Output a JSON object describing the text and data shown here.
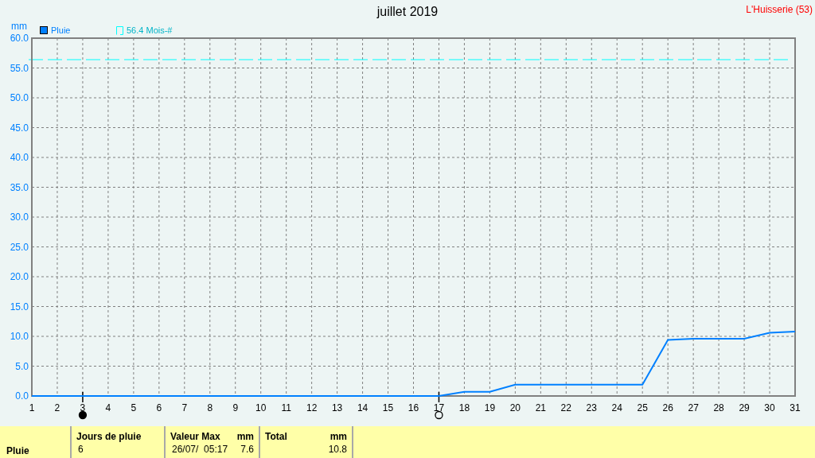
{
  "title": "juillet 2019",
  "location": "L'Huisserie (53)",
  "chart": {
    "chart_data": {
      "type": "line",
      "ylabel": "mm",
      "x": [
        1,
        2,
        3,
        4,
        5,
        6,
        7,
        8,
        9,
        10,
        11,
        12,
        13,
        14,
        15,
        16,
        17,
        18,
        19,
        20,
        21,
        22,
        23,
        24,
        25,
        26,
        27,
        28,
        29,
        30,
        31
      ],
      "xticks": [
        1,
        2,
        3,
        4,
        5,
        6,
        7,
        8,
        9,
        10,
        11,
        12,
        13,
        14,
        15,
        16,
        17,
        18,
        19,
        20,
        21,
        22,
        23,
        24,
        25,
        26,
        27,
        28,
        29,
        30,
        31
      ],
      "xlim": [
        1,
        31
      ],
      "ylim": [
        0,
        60
      ],
      "yticks": [
        {
          "value": 0,
          "label": "0.0"
        },
        {
          "value": 5,
          "label": "5.0"
        },
        {
          "value": 10,
          "label": "10.0"
        },
        {
          "value": 15,
          "label": "15.0"
        },
        {
          "value": 20,
          "label": "20.0"
        },
        {
          "value": 25,
          "label": "25.0"
        },
        {
          "value": 30,
          "label": "30.0"
        },
        {
          "value": 35,
          "label": "35.0"
        },
        {
          "value": 40,
          "label": "40.0"
        },
        {
          "value": 45,
          "label": "45.0"
        },
        {
          "value": 50,
          "label": "50.0"
        },
        {
          "value": 55,
          "label": "55.0"
        },
        {
          "value": 60,
          "label": "60.0"
        }
      ],
      "series": [
        {
          "name": "Pluie",
          "color": "#0080ff",
          "values": [
            0,
            0,
            0,
            0,
            0,
            0,
            0,
            0,
            0,
            0,
            0,
            0,
            0,
            0,
            0,
            0,
            0,
            0.7,
            0.7,
            1.9,
            1.9,
            1.9,
            1.9,
            1.9,
            1.9,
            9.4,
            9.6,
            9.6,
            9.6,
            10.6,
            10.8
          ]
        }
      ],
      "grid": true,
      "legend": "top left",
      "ref_lines": [
        {
          "axis": "y",
          "value": 56.4,
          "label": "56.4 Mois-#",
          "color": "#00ffff"
        }
      ]
    },
    "moon_markers": [
      {
        "kind": "new_moon",
        "day": "3"
      },
      {
        "kind": "full_moon",
        "day": "17"
      }
    ]
  },
  "summary": {
    "row_label": "Pluie",
    "columns": [
      {
        "header": "Jours de pluie",
        "values": [
          "6"
        ]
      },
      {
        "header": "Valeur Max",
        "unit": "mm",
        "values": [
          "26/07/  05:17",
          "7.6"
        ]
      },
      {
        "header": "Total",
        "unit": "mm",
        "values": [
          "10.8"
        ]
      }
    ]
  }
}
